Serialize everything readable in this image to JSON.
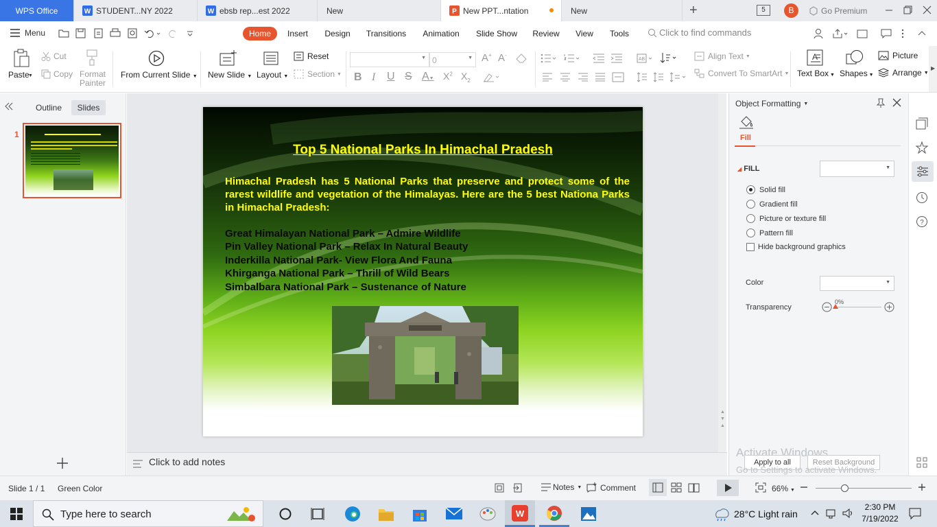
{
  "tabs": [
    {
      "label": "WPS Office",
      "active": false
    },
    {
      "label": "STUDENT...NY 2022"
    },
    {
      "label": "ebsb rep...est 2022"
    },
    {
      "label": "New"
    },
    {
      "label": "New PPT...ntation",
      "active": true
    },
    {
      "label": "New"
    }
  ],
  "tabbar_right": {
    "count": "5",
    "avatar": "B",
    "go_premium": "Go Premium"
  },
  "menu": {
    "menu_label": "Menu",
    "tabs": [
      "Home",
      "Insert",
      "Design",
      "Transitions",
      "Animation",
      "Slide Show",
      "Review",
      "View",
      "Tools"
    ],
    "active_tab": "Home",
    "search_placeholder": "Click to find commands"
  },
  "ribbon": {
    "paste": "Paste",
    "cut": "Cut",
    "copy": "Copy",
    "format_painter_1": "Format",
    "format_painter_2": "Painter",
    "from_current_slide": "From Current Slide",
    "new_slide": "New Slide",
    "layout": "Layout",
    "reset": "Reset",
    "section": "Section",
    "font_size": "0",
    "align_text": "Align Text",
    "convert_smartart": "Convert To SmartArt",
    "text_box": "Text Box",
    "shapes": "Shapes",
    "picture": "Picture",
    "arrange": "Arrange"
  },
  "leftpane": {
    "outline": "Outline",
    "slides": "Slides",
    "slide_number": "1"
  },
  "slide": {
    "title": "Top 5 National Parks In Himachal Pradesh",
    "intro": "Himachal Pradesh has 5 National Parks that preserve and protect some of the rarest wildlife and vegetation of the Himalayas. Here are the 5 best Nationa Parks in Himachal Pradesh:",
    "items": [
      "Great Himalayan National Park – Admire Wildlife",
      "Pin Valley National Park – Relax In Natural Beauty",
      "Inderkilla National Park- View Flora And Fauna",
      "Khirganga National Park – Thrill of Wild Bears",
      "Simbalbara National Park – Sustenance of Nature"
    ]
  },
  "notes_placeholder": "Click to add notes",
  "panel": {
    "title": "Object Formatting",
    "fill_tab": "Fill",
    "fill_section": "FILL",
    "options": [
      "Solid fill",
      "Gradient fill",
      "Picture or texture fill",
      "Pattern fill"
    ],
    "hide_bg": "Hide background graphics",
    "color_label": "Color",
    "transparency_label": "Transparency",
    "transparency_value": "0%",
    "apply_all": "Apply to all",
    "reset_bg": "Reset Background",
    "watermark_1": "Activate Windows",
    "watermark_2": "Go to Settings to activate Windows."
  },
  "status": {
    "slide_info": "Slide 1 / 1",
    "theme": "Green Color",
    "notes": "Notes",
    "comment": "Comment",
    "zoom": "66%"
  },
  "taskbar": {
    "search_placeholder": "Type here to search",
    "weather": "28°C  Light rain",
    "time": "2:30 PM",
    "date": "7/19/2022"
  },
  "colors": {
    "accent": "#e8542d",
    "wps_blue": "#2f6ce5",
    "title_yellow": "#ffff00"
  }
}
